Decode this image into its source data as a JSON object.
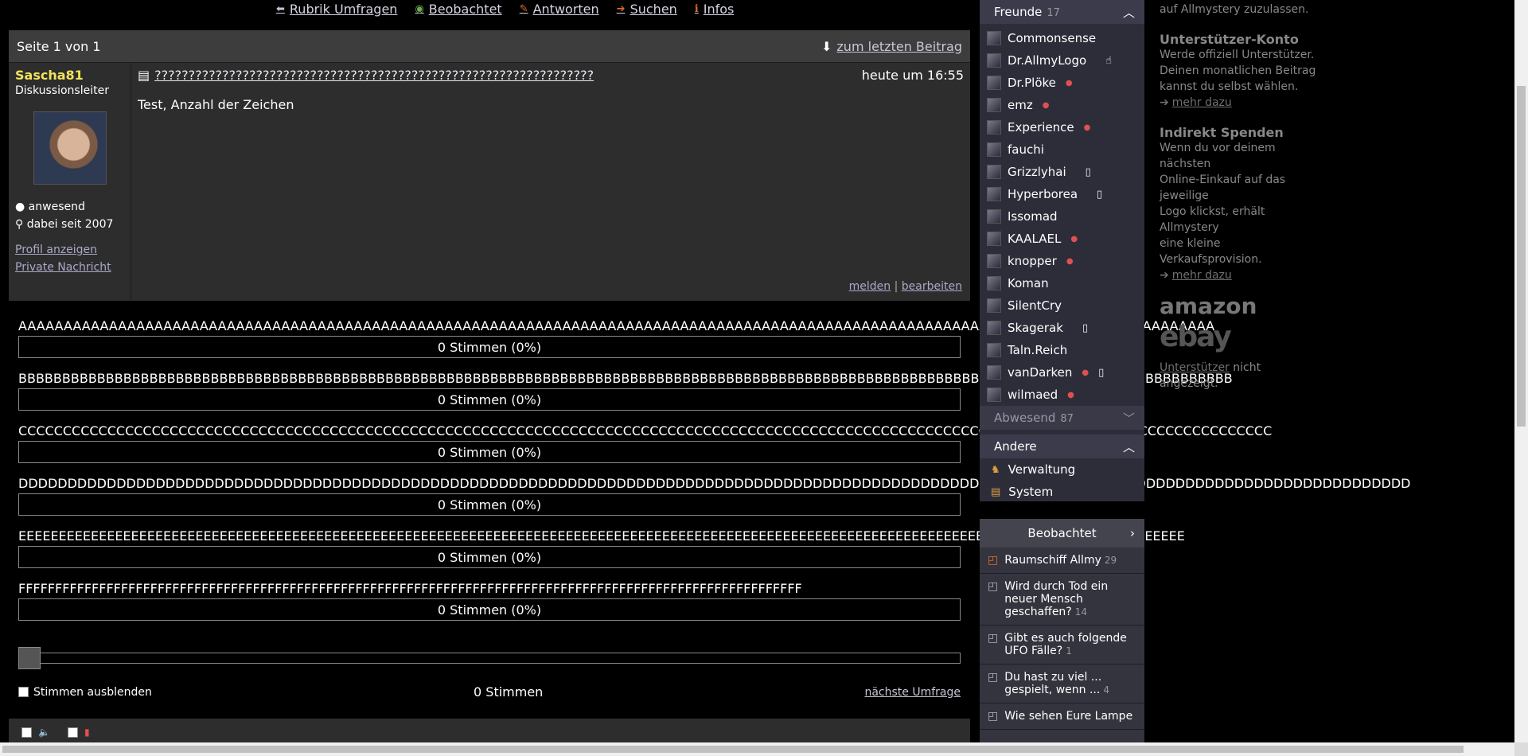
{
  "topnav": {
    "items": [
      {
        "icon": "arrow-left-icon",
        "label": "Rubrik Umfragen"
      },
      {
        "icon": "eye-icon",
        "label": "Beobachtet"
      },
      {
        "icon": "reply-icon",
        "label": "Antworten"
      },
      {
        "icon": "search-icon",
        "label": "Suchen"
      },
      {
        "icon": "info-icon",
        "label": "Infos"
      }
    ]
  },
  "pagebar": {
    "page": "Seite 1 von 1",
    "last_post": "zum letzten Beitrag"
  },
  "post": {
    "author": "Sascha81",
    "rank": "Diskussionsleiter",
    "status": "anwesend",
    "member_since": "dabei seit 2007",
    "profile_link": "Profil anzeigen",
    "pm_link": "Private Nachricht",
    "title": "?????????????????????????????????????????????????????????????????",
    "time": "heute um 16:55",
    "text": "Test, Anzahl der Zeichen",
    "report": "melden",
    "separator": "|",
    "edit": "bearbeiten"
  },
  "poll": {
    "options": [
      {
        "label": "AAAAAAAAAAAAAAAAAAAAAAAAAAAAAAAAAAAAAAAAAAAAAAAAAAAAAAAAAAAAAAAAAAAAAAAAAAAAAAAAAAAAAAAAAAAAAAAAAAAAAAAAAAAAAAAAAAAAAAAAAAAAAAAAAAAA",
        "votes": "0 Stimmen (0%)"
      },
      {
        "label": "BBBBBBBBBBBBBBBBBBBBBBBBBBBBBBBBBBBBBBBBBBBBBBBBBBBBBBBBBBBBBBBBBBBBBBBBBBBBBBBBBBBBBBBBBBBBBBBBBBBBBBBBBBBBBBBBBBBBBBBBBBBBBBBBBBBBBBBBBBB",
        "votes": "0 Stimmen (0%)"
      },
      {
        "label": "CCCCCCCCCCCCCCCCCCCCCCCCCCCCCCCCCCCCCCCCCCCCCCCCCCCCCCCCCCCCCCCCCCCCCCCCCCCCCCCCCCCCCCCCCCCCCCCCCCCCCCCCCCCCCCCCCCCCCCCCCCCCCCCCCCCCCCCCCCCCC",
        "votes": "0 Stimmen (0%)"
      },
      {
        "label": "DDDDDDDDDDDDDDDDDDDDDDDDDDDDDDDDDDDDDDDDDDDDDDDDDDDDDDDDDDDDDDDDDDDDDDDDDDDDDDDDDDDDDDDDDDDDDDDDDDDDDDDDDDDDDDDDDDDDDDDDDDDDDDDDDDDDDDDDDDDDDD",
        "votes": "0 Stimmen (0%)"
      },
      {
        "label": "EEEEEEEEEEEEEEEEEEEEEEEEEEEEEEEEEEEEEEEEEEEEEEEEEEEEEEEEEEEEEEEEEEEEEEEEEEEEEEEEEEEEEEEEEEEEEEEEEEEEEEEEEEEEEEEEEEEEEEEEEEEEEEEEEEEEEEEEEEEEEEEEE",
        "votes": "0 Stimmen (0%)"
      },
      {
        "label": "FFFFFFFFFFFFFFFFFFFFFFFFFFFFFFFFFFFFFFFFFFFFFFFFFFFFFFFFFFFFFFFFFFFFFFFFFFFFFFFFFFFFFFFFFFFFFFFFFFFFFFFFFFF",
        "votes": "0 Stimmen (0%)"
      }
    ],
    "hide_votes": "Stimmen ausblenden",
    "total": "0 Stimmen",
    "next": "nächste Umfrage",
    "slider_value": 0
  },
  "friends_panel": {
    "title": "Freunde",
    "count": "17",
    "friends": [
      {
        "name": "Commonsense",
        "dot": "",
        "mobile": ""
      },
      {
        "name": "Dr.AllmyLogo",
        "dot": "",
        "mobile": "☝"
      },
      {
        "name": "Dr.Plöke",
        "dot": "●",
        "mobile": ""
      },
      {
        "name": "emz",
        "dot": "●",
        "mobile": ""
      },
      {
        "name": "Experience",
        "dot": "●",
        "mobile": ""
      },
      {
        "name": "fauchi",
        "dot": "",
        "mobile": ""
      },
      {
        "name": "Grizzlyhai",
        "dot": "",
        "mobile": "▯"
      },
      {
        "name": "Hyperborea",
        "dot": "",
        "mobile": "▯"
      },
      {
        "name": "Issomad",
        "dot": "",
        "mobile": ""
      },
      {
        "name": "KAALAEL",
        "dot": "●",
        "mobile": ""
      },
      {
        "name": "knopper",
        "dot": "●",
        "mobile": ""
      },
      {
        "name": "Koman",
        "dot": "",
        "mobile": ""
      },
      {
        "name": "SilentCry",
        "dot": "",
        "mobile": ""
      },
      {
        "name": "Skagerak",
        "dot": "",
        "mobile": "▯"
      },
      {
        "name": "Taln.Reich",
        "dot": "",
        "mobile": ""
      },
      {
        "name": "vanDarken",
        "dot": "●",
        "mobile": "▯"
      },
      {
        "name": "wilmaed",
        "dot": "●",
        "mobile": ""
      }
    ],
    "absent_title": "Abwesend",
    "absent_count": "87",
    "other_title": "Andere",
    "other_items": [
      "Verwaltung",
      "System"
    ]
  },
  "watch_panel": {
    "title": "Beobachtet",
    "items": [
      {
        "title": "Raumschiff Allmy",
        "count": "29"
      },
      {
        "title": "Wird durch Tod ein neuer Mensch geschaffen?",
        "count": "14"
      },
      {
        "title": "Gibt es auch folgende UFO Fälle?",
        "count": "1"
      },
      {
        "title": "Du hast zu viel ... gespielt, wenn ...",
        "count": "4"
      },
      {
        "title": "Wie sehen Eure Lampe",
        "count": ""
      }
    ]
  },
  "sidebar": {
    "intro": "auf Allmystery zuzulassen.",
    "supporter_title": "Unterstützer-Konto",
    "supporter_lines": [
      "Werde offiziell Unterstützer.",
      "Deinen monatlichen Beitrag",
      "kannst du selbst wählen."
    ],
    "more1": "mehr dazu",
    "indirect_title": "Indirekt Spenden",
    "indirect_lines": [
      "Wenn du vor deinem nächsten",
      "Online-Einkauf auf das jeweilige",
      "Logo klickst, erhält Allmystery",
      "eine kleine Verkaufsprovision."
    ],
    "more2": "mehr dazu",
    "logo1": "amazon",
    "logo2": "ebay",
    "supporter_link": "Unterstützer",
    "supporter_suffix": "nicht angezeigt."
  }
}
